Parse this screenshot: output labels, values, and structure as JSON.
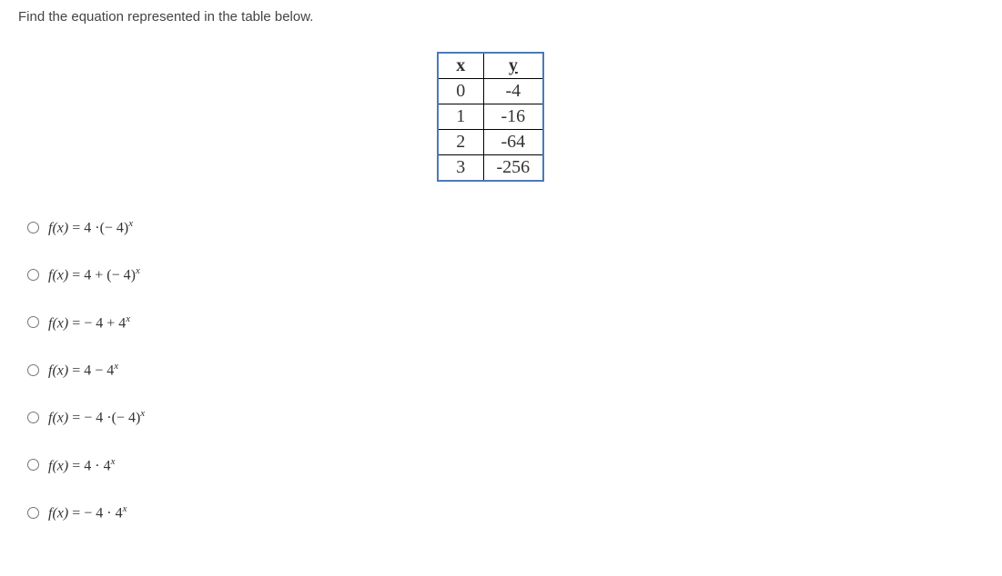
{
  "prompt": "Find the equation represented in the table below.",
  "table": {
    "headers": {
      "x": "x",
      "y": "y"
    },
    "rows": [
      {
        "x": "0",
        "y": "-4"
      },
      {
        "x": "1",
        "y": "-16"
      },
      {
        "x": "2",
        "y": "-64"
      },
      {
        "x": "3",
        "y": "-256"
      }
    ]
  },
  "options": [
    {
      "html": "<span class='fn'>f</span>(<span class='fn'>x</span>) <span class='normal'>= 4 ·(− 4)</span><sup>x</sup>"
    },
    {
      "html": "<span class='fn'>f</span>(<span class='fn'>x</span>) <span class='normal'>= 4 + (− 4)</span><sup>x</sup>"
    },
    {
      "html": "<span class='fn'>f</span>(<span class='fn'>x</span>) <span class='normal'>= − 4 + 4</span><sup>x</sup>"
    },
    {
      "html": "<span class='fn'>f</span>(<span class='fn'>x</span>) <span class='normal'>= 4 − 4</span><sup>x</sup>"
    },
    {
      "html": "<span class='fn'>f</span>(<span class='fn'>x</span>) <span class='normal'>= − 4 ·(− 4)</span><sup>x</sup>"
    },
    {
      "html": "<span class='fn'>f</span>(<span class='fn'>x</span>) <span class='normal'>= 4 · 4</span><sup>x</sup>"
    },
    {
      "html": "<span class='fn'>f</span>(<span class='fn'>x</span>) <span class='normal'>= − 4 · 4</span><sup>x</sup>"
    }
  ],
  "chart_data": {
    "type": "table",
    "columns": [
      "x",
      "y"
    ],
    "rows": [
      [
        0,
        -4
      ],
      [
        1,
        -16
      ],
      [
        2,
        -64
      ],
      [
        3,
        -256
      ]
    ]
  }
}
